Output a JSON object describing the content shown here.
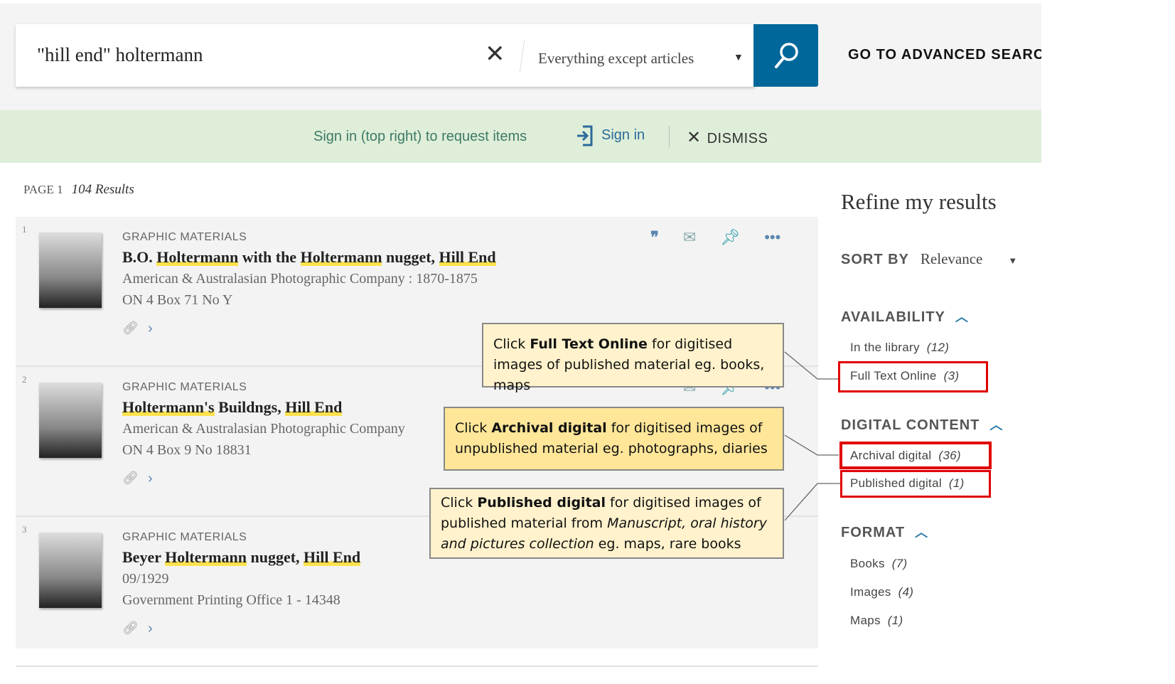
{
  "search": {
    "query": "\"hill end\" holtermann",
    "scope": "Everything except articles",
    "advanced_label": "GO TO ADVANCED SEARCH"
  },
  "banner": {
    "message": "Sign in (top right) to request items",
    "signin": "Sign in",
    "dismiss": "DISMISS"
  },
  "results_info": {
    "page": "PAGE 1",
    "count": "104 Results"
  },
  "results": [
    {
      "num": "1",
      "type": "GRAPHIC MATERIALS",
      "title_parts": [
        "B.O. ",
        "Holtermann",
        " with the ",
        "Holtermann",
        " nugget, ",
        "Hill End"
      ],
      "line1": "American & Australasian Photographic Company : 1870-1875",
      "line2": "ON 4 Box 71 No Y"
    },
    {
      "num": "2",
      "type": "GRAPHIC MATERIALS",
      "title_parts": [
        "",
        "Holtermann's",
        " Buildngs, ",
        "Hill End"
      ],
      "line1": "American & Australasian Photographic Company",
      "line2": "ON 4 Box 9 No 18831"
    },
    {
      "num": "3",
      "type": "GRAPHIC MATERIALS",
      "title_parts": [
        "Beyer ",
        "Holtermann",
        " nugget, ",
        "Hill End"
      ],
      "line1": "09/1929",
      "line2": "Government Printing Office 1 - 14348"
    }
  ],
  "callouts": [
    {
      "pre": "Click ",
      "bold": "Full Text Online",
      "post": " for digitised images of published material eg. books, maps"
    },
    {
      "pre": "Click ",
      "bold": "Archival digital",
      "post": " for digitised images of unpublished material eg. photographs, diaries"
    },
    {
      "pre": "Click ",
      "bold": "Published digital",
      "post": " for digitised images of published material from ",
      "italic": "Manuscript, oral history and pictures collection",
      "post2": " eg. maps, rare books"
    }
  ],
  "sidebar": {
    "title": "Refine my results",
    "sort_label": "SORT BY",
    "sort_value": "Relevance",
    "availability": {
      "label": "AVAILABILITY",
      "items": [
        {
          "label": "In the library",
          "count": "(12)"
        },
        {
          "label": "Full Text Online",
          "count": "(3)"
        }
      ]
    },
    "digital": {
      "label": "DIGITAL CONTENT",
      "items": [
        {
          "label": "Archival digital",
          "count": "(36)"
        },
        {
          "label": "Published digital",
          "count": "(1)"
        }
      ]
    },
    "format": {
      "label": "FORMAT",
      "items": [
        {
          "label": "Books",
          "count": "(7)"
        },
        {
          "label": "Images",
          "count": "(4)"
        },
        {
          "label": "Maps",
          "count": "(1)"
        }
      ]
    }
  },
  "colors": {
    "search_button": "#00679a",
    "banner_bg": "#dfeed8",
    "highlight": "#ffe14d",
    "annotation_box": "#e00000",
    "callout_bg": "#fff2cc"
  }
}
